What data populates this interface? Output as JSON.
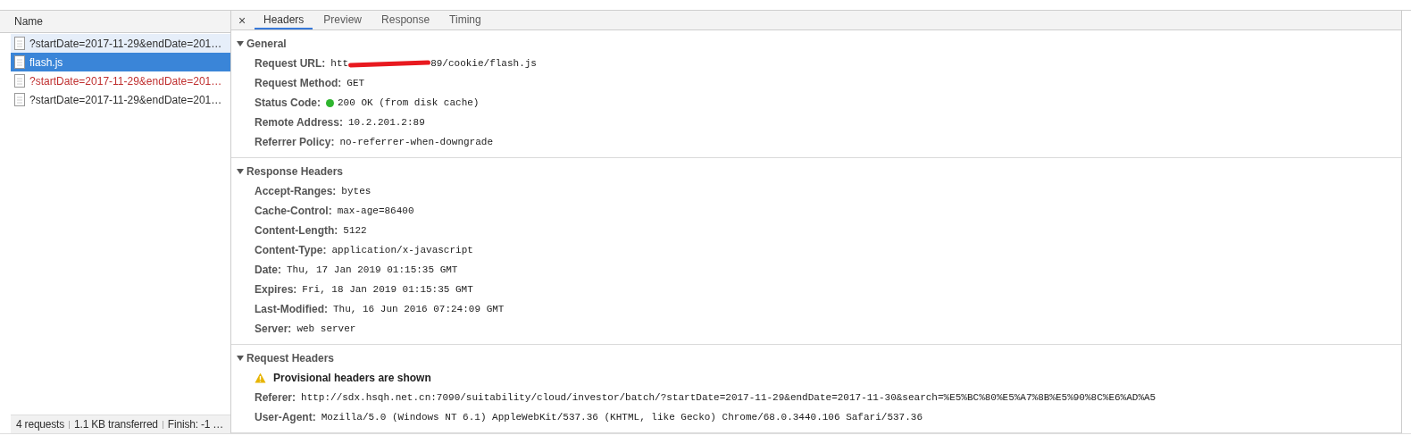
{
  "list": {
    "column": "Name",
    "items": [
      {
        "name": "?startDate=2017-11-29&endDate=201…",
        "kind": "ok",
        "selected": false,
        "highlighted": true
      },
      {
        "name": "flash.js",
        "kind": "ok",
        "selected": true,
        "highlighted": false
      },
      {
        "name": "?startDate=2017-11-29&endDate=201…",
        "kind": "error",
        "selected": false,
        "highlighted": false
      },
      {
        "name": "?startDate=2017-11-29&endDate=201…",
        "kind": "ok",
        "selected": false,
        "highlighted": false
      }
    ]
  },
  "status_bar": [
    "4 requests",
    "1.1 KB transferred",
    "Finish: -1 …"
  ],
  "detail": {
    "close": "×",
    "tabs": [
      {
        "label": "Headers",
        "selected": true
      },
      {
        "label": "Preview",
        "selected": false
      },
      {
        "label": "Response",
        "selected": false
      },
      {
        "label": "Timing",
        "selected": false
      }
    ],
    "sections": [
      {
        "title": "General",
        "expanded": true,
        "rows": [
          {
            "kind": "redacted",
            "name": "Request URL:",
            "value_start": "htt",
            "value_end": "89/cookie/flash.js"
          },
          {
            "kind": "field",
            "name": "Request Method:",
            "value": "GET"
          },
          {
            "kind": "status",
            "name": "Status Code:",
            "value": "200 OK (from disk cache)",
            "color": "#2fb52f"
          },
          {
            "kind": "field",
            "name": "Remote Address:",
            "value": "10.2.201.2:89"
          },
          {
            "kind": "field",
            "name": "Referrer Policy:",
            "value": "no-referrer-when-downgrade"
          }
        ]
      },
      {
        "title": "Response Headers",
        "expanded": true,
        "rows": [
          {
            "kind": "field",
            "name": "Accept-Ranges:",
            "value": "bytes"
          },
          {
            "kind": "field",
            "name": "Cache-Control:",
            "value": "max-age=86400"
          },
          {
            "kind": "field",
            "name": "Content-Length:",
            "value": "5122"
          },
          {
            "kind": "field",
            "name": "Content-Type:",
            "value": "application/x-javascript"
          },
          {
            "kind": "field",
            "name": "Date:",
            "value": "Thu, 17 Jan 2019 01:15:35 GMT"
          },
          {
            "kind": "field",
            "name": "Expires:",
            "value": "Fri, 18 Jan 2019 01:15:35 GMT"
          },
          {
            "kind": "field",
            "name": "Last-Modified:",
            "value": "Thu, 16 Jun 2016 07:24:09 GMT"
          },
          {
            "kind": "field",
            "name": "Server:",
            "value": "web server"
          }
        ]
      },
      {
        "title": "Request Headers",
        "expanded": true,
        "rows": [
          {
            "kind": "warning",
            "text": "Provisional headers are shown"
          },
          {
            "kind": "field",
            "name": "Referer:",
            "value": "http://sdx.hsqh.net.cn:7090/suitability/cloud/investor/batch/?startDate=2017-11-29&endDate=2017-11-30&search=%E5%BC%80%E5%A7%8B%E5%90%8C%E6%AD%A5"
          },
          {
            "kind": "field",
            "name": "User-Agent:",
            "value": "Mozilla/5.0 (Windows NT 6.1) AppleWebKit/537.36 (KHTML, like Gecko) Chrome/68.0.3440.106 Safari/537.36"
          }
        ]
      }
    ]
  }
}
